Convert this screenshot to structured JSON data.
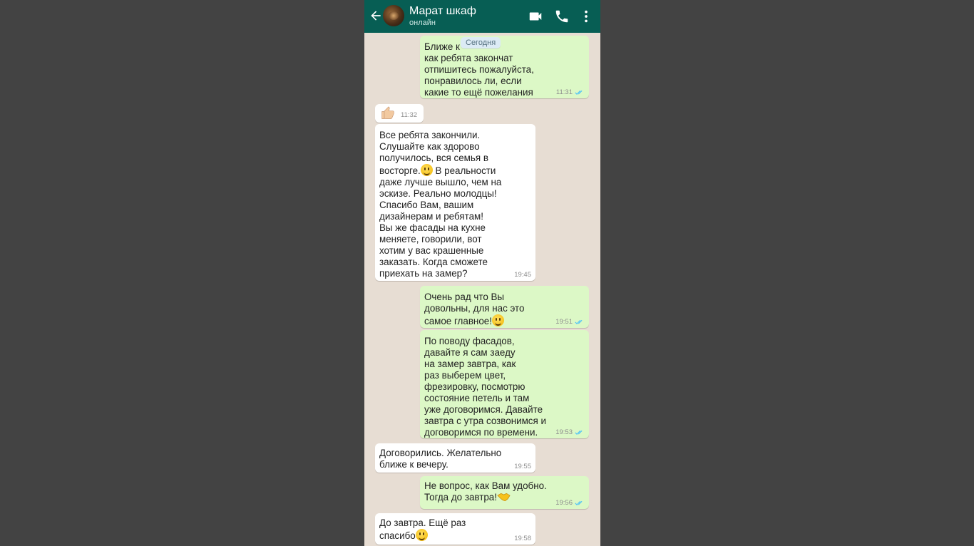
{
  "header": {
    "contact_name": "Марат шкаф",
    "status": "онлайн"
  },
  "icons": {
    "back": "arrow-back-icon",
    "video": "video-call-icon",
    "call": "phone-call-icon",
    "menu": "more-vert-icon"
  },
  "colors": {
    "header": "#075e54",
    "outgoing_bubble": "#dcf8c6",
    "incoming_bubble": "#ffffff",
    "chat_background": "#e7ddd3",
    "read_ticks": "#4fc3f7"
  },
  "date_pill": "Сегодня",
  "messages": [
    {
      "direction": "out",
      "text": "Ближе к вечеру пожалуйста как ребята закончат отпишитесь пожалуйста, понравилось ли, если какие то ещё пожелания",
      "visible_text": "Ближе к\nкак ребята закончат\nотпишитесь пожалуйста,\nпонравилось ли, если\nкакие то ещё пожелания",
      "time": "11:31",
      "read": true
    },
    {
      "direction": "in",
      "text": "👍",
      "time": "11:32"
    },
    {
      "direction": "in",
      "text_part1": "Все ребята закончили.\nСлушайте как здорово\nполучилось, вся семья в\nвосторге.",
      "text_part2": " В реальности\nдаже лучше вышло, чем на\nэскизе. Реально молодцы!\nСпасибо Вам, вашим\nдизайнерам и ребятам!\nВы же фасады на кухне\nменяете, говорили, вот\nхотим у вас крашенные\nзаказать. Когда сможете\nприехать на замер?",
      "time": "19:45"
    },
    {
      "direction": "out",
      "text": "Очень рад что Вы\nдовольны, для нас это\nсамое главное!",
      "time": "19:51",
      "read": true
    },
    {
      "direction": "out",
      "text": "По поводу фасадов,\nдавайте я сам заеду\nна замер завтра, как\nраз выберем цвет,\nфрезировку, посмотрю\nсостояние петель и там\nуже договоримся. Давайте\nзавтра с утра созвонимся и\nдоговоримся по времени.",
      "time": "19:53",
      "read": true
    },
    {
      "direction": "in",
      "text": "Договорились. Желательно\nближе к вечеру.",
      "time": "19:55"
    },
    {
      "direction": "out",
      "text": "Не вопрос, как Вам удобно.\nТогда до завтра!",
      "time": "19:56",
      "read": true
    },
    {
      "direction": "in",
      "text": "До завтра. Ещё раз\nспасибо",
      "time": "19:58"
    }
  ]
}
